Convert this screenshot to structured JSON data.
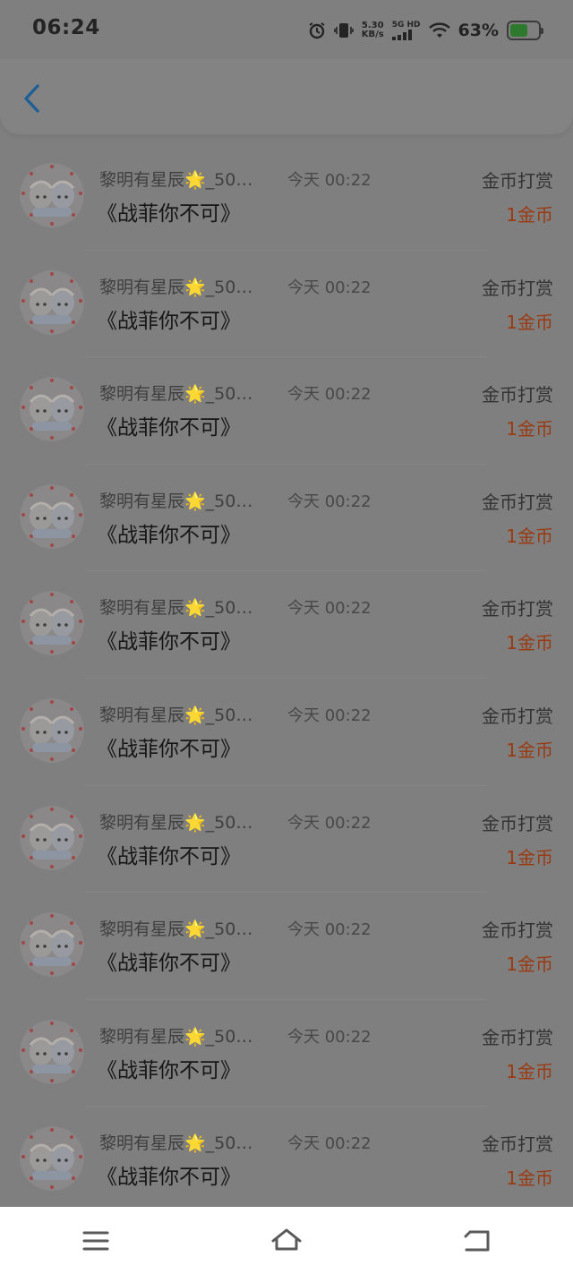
{
  "status_bar": {
    "time": "06:24",
    "net_speed_value": "5.30",
    "net_speed_unit": "KB/s",
    "network_label": "5G HD",
    "battery_percent": "63%",
    "battery_level": 0.63,
    "icons": [
      "alarm-icon",
      "vibrate-icon",
      "signal-icon",
      "wifi-icon",
      "battery-icon"
    ]
  },
  "header": {
    "back_icon": "chevron-left-icon"
  },
  "rewards": [
    {
      "user": "黎明有星辰🌟_50…",
      "time": "今天 00:22",
      "title": "《战菲你不可》",
      "type": "金币打赏",
      "amount": "1金币"
    },
    {
      "user": "黎明有星辰🌟_50…",
      "time": "今天 00:22",
      "title": "《战菲你不可》",
      "type": "金币打赏",
      "amount": "1金币"
    },
    {
      "user": "黎明有星辰🌟_50…",
      "time": "今天 00:22",
      "title": "《战菲你不可》",
      "type": "金币打赏",
      "amount": "1金币"
    },
    {
      "user": "黎明有星辰🌟_50…",
      "time": "今天 00:22",
      "title": "《战菲你不可》",
      "type": "金币打赏",
      "amount": "1金币"
    },
    {
      "user": "黎明有星辰🌟_50…",
      "time": "今天 00:22",
      "title": "《战菲你不可》",
      "type": "金币打赏",
      "amount": "1金币"
    },
    {
      "user": "黎明有星辰🌟_50…",
      "time": "今天 00:22",
      "title": "《战菲你不可》",
      "type": "金币打赏",
      "amount": "1金币"
    },
    {
      "user": "黎明有星辰🌟_50…",
      "time": "今天 00:22",
      "title": "《战菲你不可》",
      "type": "金币打赏",
      "amount": "1金币"
    },
    {
      "user": "黎明有星辰🌟_50…",
      "time": "今天 00:22",
      "title": "《战菲你不可》",
      "type": "金币打赏",
      "amount": "1金币"
    },
    {
      "user": "黎明有星辰🌟_50…",
      "time": "今天 00:22",
      "title": "《战菲你不可》",
      "type": "金币打赏",
      "amount": "1金币"
    },
    {
      "user": "黎明有星辰🌟_50…",
      "time": "今天 00:22",
      "title": "《战菲你不可》",
      "type": "金币打赏",
      "amount": "1金币"
    }
  ],
  "nav_bar": {
    "icons": [
      "menu-icon",
      "home-icon",
      "back-icon"
    ]
  },
  "colors": {
    "scrim_background": "#7f7f7f",
    "amount_accent": "#9a3a10",
    "back_chevron": "#1f5f96",
    "battery_fill": "#2d7a2e"
  }
}
